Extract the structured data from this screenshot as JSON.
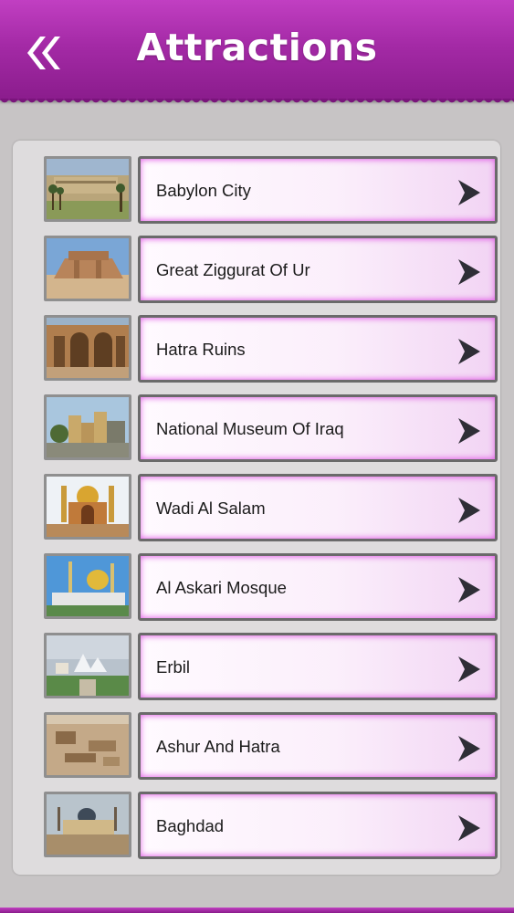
{
  "header": {
    "title": "Attractions",
    "back_icon": "double-chevron-left-icon",
    "color_top": "#c13fc2",
    "color_bottom": "#8a1c8c"
  },
  "list": {
    "arrow_icon": "chevron-right-icon",
    "items": [
      {
        "label": "Babylon City",
        "thumb": "babylon-city-thumbnail"
      },
      {
        "label": "Great Ziggurat Of Ur",
        "thumb": "ziggurat-thumbnail"
      },
      {
        "label": "Hatra Ruins",
        "thumb": "hatra-ruins-thumbnail"
      },
      {
        "label": "National Museum Of Iraq",
        "thumb": "museum-thumbnail"
      },
      {
        "label": "Wadi Al Salam",
        "thumb": "wadi-al-salam-thumbnail"
      },
      {
        "label": "Al Askari Mosque",
        "thumb": "askari-mosque-thumbnail"
      },
      {
        "label": "Erbil",
        "thumb": "erbil-thumbnail"
      },
      {
        "label": "Ashur And Hatra",
        "thumb": "ashur-hatra-thumbnail"
      },
      {
        "label": "Baghdad",
        "thumb": "baghdad-thumbnail"
      }
    ]
  }
}
